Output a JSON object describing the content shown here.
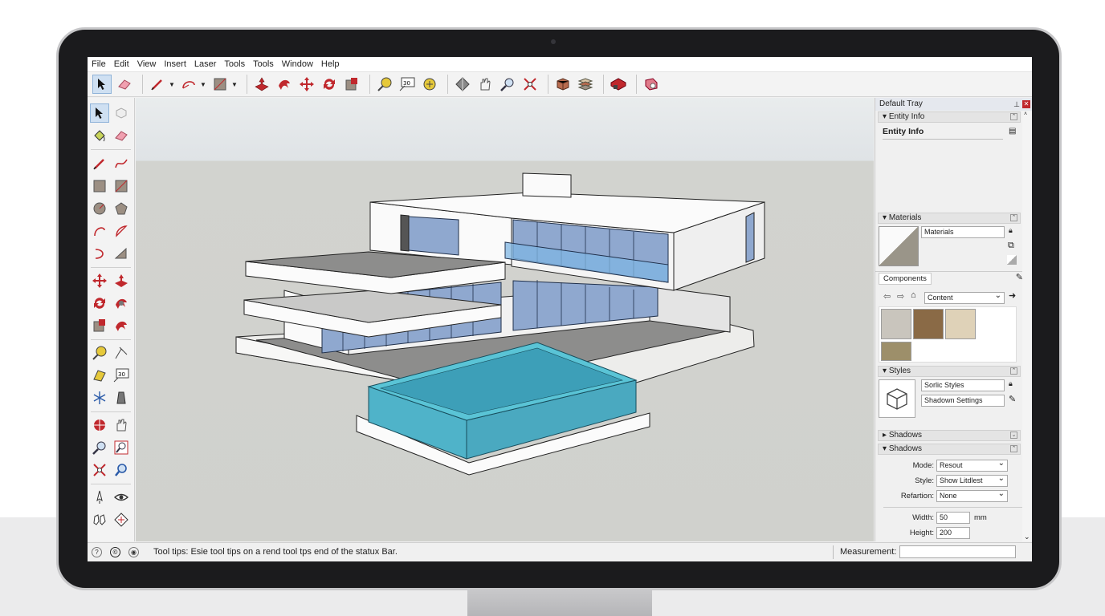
{
  "menu": [
    "File",
    "Edit",
    "View",
    "Insert",
    "Laser",
    "Tools",
    "Tools",
    "Window",
    "Help"
  ],
  "top_toolbar_icons": [
    "select-arrow-icon",
    "eraser-icon",
    "pencil-line-icon",
    "dropdown-arrow-icon",
    "arc-icon",
    "dropdown-arrow-icon",
    "rectangle-icon",
    "dropdown-arrow-icon",
    "push-pull-icon",
    "follow-me-icon",
    "move-icon",
    "rotate-icon",
    "scale-icon",
    "tape-measure-icon",
    "dimension-icon",
    "protractor-icon",
    "orbit-icon",
    "pan-icon",
    "zoom-icon",
    "zoom-extents-icon",
    "component-icon",
    "layers-icon",
    "warehouse-icon",
    "extension-warehouse-icon"
  ],
  "left_toolbar_icons": [
    "select-icon",
    "make-component-icon",
    "paint-bucket-icon",
    "eraser-icon",
    "line-icon",
    "freehand-icon",
    "rectangle-icon",
    "rotated-rectangle-icon",
    "circle-icon",
    "polygon-icon",
    "arc-icon",
    "pie-icon",
    "two-point-arc-icon",
    "three-point-arc-icon",
    "move-icon",
    "push-pull-icon",
    "rotate-icon",
    "follow-me-icon",
    "scale-icon",
    "offset-icon",
    "tape-measure-icon",
    "dimension-icon",
    "protractor-icon",
    "text-icon",
    "axes-icon",
    "3d-text-icon",
    "orbit-icon",
    "pan-icon",
    "zoom-icon",
    "zoom-window-icon",
    "zoom-extents-icon",
    "search-icon",
    "position-camera-icon",
    "look-around-icon",
    "walk-icon",
    "section-plane-icon"
  ],
  "tray": {
    "title": "Default Tray",
    "entity_info": {
      "header": "Entity Info",
      "title": "Entity Info"
    },
    "materials": {
      "header": "Materials",
      "name_value": "Materials"
    },
    "components": {
      "tab": "Components",
      "dropdown": "Content",
      "swatch_colors": [
        "#c9c5bd",
        "#8a6a46",
        "#dfd2b8",
        "#9d8f6a"
      ]
    },
    "styles": {
      "header": "Styles",
      "row1": "Sorlic Styles",
      "row2": "Shadown Settings"
    },
    "shadows_collapsed": "Shadows",
    "shadows": {
      "header": "Shadows",
      "mode_label": "Mode:",
      "mode_value": "Resout",
      "style_label": "Style:",
      "style_value": "Show Litdlest",
      "refraction_label": "Refartion:",
      "refraction_value": "None",
      "width_label": "Width:",
      "width_value": "50",
      "width_unit": "mm",
      "height_label": "Height:",
      "height_value": "200"
    }
  },
  "status": {
    "tooltip": "Tool tips: Esie tool tips on a rend tool tps end of the statux Bar.",
    "measurement_label": "Measurement:",
    "measurement_value": ""
  },
  "colors": {
    "accent_red": "#c0282d",
    "glass": "#8fa8cf",
    "pool_water": "#4fb3c9",
    "selection": "#cfe0f2"
  }
}
